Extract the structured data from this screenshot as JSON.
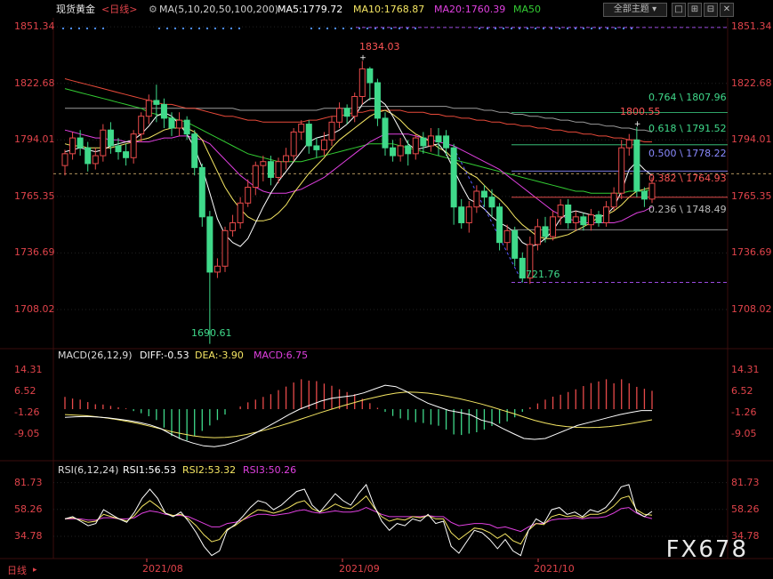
{
  "header": {
    "symbol": "现货黄金",
    "period": "<日线>",
    "ma_spec": "MA(5,10,20,50,100,200)",
    "ma5": "MA5:1779.72",
    "ma10": "MA10:1768.87",
    "ma20": "MA20:1760.39",
    "ma50": "MA50",
    "dropdown": "全部主题",
    "colors": {
      "ma5": "#ffffff",
      "ma10": "#f5e663",
      "ma20": "#e040e0",
      "ma50": "#33cc33",
      "ma100": "#e84a3a",
      "ma200": "#9a9a9a",
      "up": "#e84a4a",
      "down": "#3fd98a"
    }
  },
  "price_axis": {
    "ticks": [
      "1851.34",
      "1822.68",
      "1794.01",
      "1765.35",
      "1736.69",
      "1708.02"
    ]
  },
  "annotations": {
    "high1": "1834.03",
    "low1": "1690.61",
    "high2": "1800.55",
    "low2": "1721.76"
  },
  "fib": {
    "l764": "0.764 \\ 1807.96",
    "l618": "0.618 \\ 1791.52",
    "l500": "0.500 \\ 1778.22",
    "l382": "0.382 \\ 1764.93",
    "l236": "0.236 \\ 1748.49"
  },
  "macd": {
    "title": "MACD(26,12,9)",
    "diff": "DIFF:-0.53",
    "dea": "DEA:-3.90",
    "macd": "MACD:6.75",
    "ticks": [
      "14.31",
      "6.52",
      "-1.26",
      "-9.05"
    ]
  },
  "rsi": {
    "title": "RSI(6,12,24)",
    "rsi1": "RSI1:56.53",
    "rsi2": "RSI2:53.32",
    "rsi3": "RSI3:50.26",
    "ticks": [
      "81.73",
      "58.26",
      "34.78"
    ]
  },
  "time_axis": {
    "period": "日线",
    "labels": [
      "2021/08",
      "2021/09",
      "2021/10"
    ]
  },
  "watermark": "FX678",
  "chart_data": {
    "type": "candlestick",
    "candles": [
      [
        1781,
        1787,
        1776,
        1789
      ],
      [
        1787,
        1795,
        1784,
        1798
      ],
      [
        1795,
        1790,
        1786,
        1799
      ],
      [
        1790,
        1782,
        1778,
        1793
      ],
      [
        1782,
        1786,
        1779,
        1790
      ],
      [
        1786,
        1799,
        1783,
        1802
      ],
      [
        1799,
        1791,
        1787,
        1803
      ],
      [
        1791,
        1788,
        1784,
        1795
      ],
      [
        1788,
        1785,
        1781,
        1792
      ],
      [
        1785,
        1797,
        1782,
        1799
      ],
      [
        1797,
        1806,
        1793,
        1808
      ],
      [
        1806,
        1814,
        1802,
        1817
      ],
      [
        1814,
        1812,
        1803,
        1822
      ],
      [
        1812,
        1805,
        1800,
        1815
      ],
      [
        1805,
        1800,
        1796,
        1808
      ],
      [
        1800,
        1804,
        1796,
        1808
      ],
      [
        1804,
        1797,
        1794,
        1806
      ],
      [
        1797,
        1780,
        1776,
        1799
      ],
      [
        1780,
        1755,
        1750,
        1782
      ],
      [
        1755,
        1727,
        1690.61,
        1758
      ],
      [
        1727,
        1730,
        1724,
        1734
      ],
      [
        1730,
        1748,
        1727,
        1750
      ],
      [
        1748,
        1752,
        1745,
        1756
      ],
      [
        1752,
        1762,
        1749,
        1765
      ],
      [
        1762,
        1770,
        1760,
        1774
      ],
      [
        1770,
        1781,
        1766,
        1783
      ],
      [
        1781,
        1783,
        1773,
        1786
      ],
      [
        1783,
        1775,
        1771,
        1786
      ],
      [
        1775,
        1783,
        1772,
        1785
      ],
      [
        1783,
        1786,
        1779,
        1790
      ],
      [
        1786,
        1798,
        1783,
        1800
      ],
      [
        1798,
        1802,
        1794,
        1804
      ],
      [
        1802,
        1791,
        1787,
        1804
      ],
      [
        1791,
        1789,
        1785,
        1795
      ],
      [
        1789,
        1794,
        1786,
        1798
      ],
      [
        1794,
        1803,
        1791,
        1806
      ],
      [
        1803,
        1810,
        1800,
        1813
      ],
      [
        1810,
        1806,
        1802,
        1812
      ],
      [
        1806,
        1816,
        1803,
        1818
      ],
      [
        1816,
        1830,
        1812,
        1834.03
      ],
      [
        1830,
        1823,
        1814,
        1831
      ],
      [
        1823,
        1805,
        1801,
        1825
      ],
      [
        1805,
        1790,
        1786,
        1808
      ],
      [
        1790,
        1786,
        1783,
        1794
      ],
      [
        1786,
        1791,
        1783,
        1795
      ],
      [
        1791,
        1787,
        1781,
        1794
      ],
      [
        1787,
        1795,
        1784,
        1797
      ],
      [
        1795,
        1791,
        1787,
        1798
      ],
      [
        1791,
        1796,
        1788,
        1800
      ],
      [
        1796,
        1793,
        1786,
        1800
      ],
      [
        1796,
        1790,
        1786,
        1799
      ],
      [
        1790,
        1760,
        1751,
        1792
      ],
      [
        1760,
        1752,
        1749,
        1764
      ],
      [
        1752,
        1760,
        1747,
        1763
      ],
      [
        1760,
        1768,
        1757,
        1771
      ],
      [
        1768,
        1765,
        1760,
        1771
      ],
      [
        1765,
        1760,
        1755,
        1769
      ],
      [
        1760,
        1742,
        1738,
        1762
      ],
      [
        1742,
        1748,
        1738,
        1751
      ],
      [
        1748,
        1734,
        1730,
        1750
      ],
      [
        1734,
        1724,
        1721.76,
        1737
      ],
      [
        1724,
        1741,
        1721,
        1745
      ],
      [
        1741,
        1750,
        1738,
        1754
      ],
      [
        1750,
        1745,
        1742,
        1755
      ],
      [
        1745,
        1755,
        1743,
        1758
      ],
      [
        1755,
        1761,
        1751,
        1764
      ],
      [
        1761,
        1752,
        1749,
        1764
      ],
      [
        1752,
        1755,
        1748,
        1758
      ],
      [
        1755,
        1751,
        1748,
        1757
      ],
      [
        1751,
        1756,
        1748,
        1759
      ],
      [
        1756,
        1752,
        1750,
        1758
      ],
      [
        1752,
        1760,
        1750,
        1763
      ],
      [
        1760,
        1767,
        1758,
        1770
      ],
      [
        1767,
        1790,
        1764,
        1794
      ],
      [
        1790,
        1794,
        1786,
        1797
      ],
      [
        1794,
        1768,
        1765,
        1800.55
      ],
      [
        1768,
        1764,
        1760,
        1770
      ],
      [
        1764,
        1772,
        1762,
        1775
      ]
    ],
    "ma": {
      "ma5": [
        1788,
        1789,
        1790,
        1789,
        1788,
        1789,
        1791,
        1792,
        1793,
        1794,
        1797,
        1801,
        1806,
        1808,
        1806,
        1802,
        1797,
        1790,
        1780,
        1767,
        1754,
        1746,
        1742,
        1740,
        1744,
        1752,
        1760,
        1767,
        1773,
        1778,
        1783,
        1788,
        1793,
        1795,
        1796,
        1797,
        1799,
        1802,
        1806,
        1812,
        1815,
        1815,
        1812,
        1806,
        1799,
        1792,
        1789,
        1790,
        1791,
        1792,
        1787,
        1779,
        1771,
        1764,
        1762,
        1759,
        1755,
        1752,
        1750,
        1747,
        1742,
        1740,
        1741,
        1744,
        1748,
        1754,
        1757,
        1758,
        1757,
        1756,
        1755,
        1756,
        1760,
        1768,
        1779,
        1783,
        1779,
        1776
      ],
      "ma10": [
        1792,
        1791,
        1791,
        1790,
        1790,
        1790,
        1790,
        1791,
        1792,
        1793,
        1794,
        1795,
        1797,
        1799,
        1800,
        1800,
        1800,
        1798,
        1794,
        1786,
        1778,
        1770,
        1764,
        1759,
        1755,
        1753,
        1753,
        1754,
        1757,
        1761,
        1767,
        1772,
        1777,
        1781,
        1785,
        1790,
        1794,
        1797,
        1800,
        1803,
        1806,
        1808,
        1809,
        1807,
        1804,
        1800,
        1797,
        1795,
        1793,
        1790,
        1788,
        1784,
        1780,
        1777,
        1775,
        1771,
        1767,
        1764,
        1760,
        1755,
        1751,
        1748,
        1745,
        1744,
        1744,
        1745,
        1746,
        1748,
        1750,
        1752,
        1755,
        1756,
        1758,
        1761,
        1765,
        1768,
        1769,
        1770
      ],
      "ma20": [
        1799,
        1798,
        1797,
        1796,
        1795,
        1795,
        1794,
        1794,
        1793,
        1793,
        1793,
        1793,
        1794,
        1795,
        1795,
        1796,
        1796,
        1795,
        1794,
        1792,
        1788,
        1784,
        1780,
        1776,
        1773,
        1770,
        1768,
        1767,
        1767,
        1767,
        1768,
        1769,
        1771,
        1773,
        1775,
        1778,
        1781,
        1784,
        1787,
        1790,
        1793,
        1795,
        1797,
        1797,
        1797,
        1797,
        1796,
        1795,
        1794,
        1793,
        1792,
        1791,
        1789,
        1787,
        1785,
        1783,
        1781,
        1779,
        1776,
        1773,
        1770,
        1767,
        1764,
        1761,
        1758,
        1756,
        1754,
        1753,
        1752,
        1752,
        1752,
        1752,
        1752,
        1753,
        1755,
        1757,
        1758,
        1760
      ],
      "ma50": [
        1820,
        1819,
        1818,
        1817,
        1816,
        1815,
        1814,
        1813,
        1812,
        1811,
        1810,
        1808,
        1807,
        1806,
        1805,
        1804,
        1803,
        1801,
        1799,
        1797,
        1795,
        1793,
        1791,
        1789,
        1787,
        1786,
        1785,
        1784,
        1783,
        1783,
        1783,
        1783,
        1784,
        1785,
        1786,
        1787,
        1788,
        1789,
        1790,
        1791,
        1792,
        1792,
        1792,
        1792,
        1791,
        1790,
        1789,
        1788,
        1787,
        1786,
        1785,
        1784,
        1783,
        1782,
        1781,
        1780,
        1779,
        1778,
        1777,
        1776,
        1775,
        1774,
        1773,
        1772,
        1771,
        1770,
        1769,
        1768,
        1768,
        1767,
        1767,
        1767,
        1767,
        1767,
        1768,
        1768,
        1768,
        1769
      ],
      "ma100": [
        1825,
        1824,
        1823,
        1822,
        1821,
        1820,
        1819,
        1818,
        1817,
        1816,
        1815,
        1814,
        1813,
        1812,
        1812,
        1811,
        1810,
        1810,
        1809,
        1808,
        1807,
        1806,
        1806,
        1805,
        1804,
        1804,
        1803,
        1803,
        1803,
        1803,
        1803,
        1803,
        1804,
        1804,
        1805,
        1806,
        1806,
        1807,
        1808,
        1808,
        1809,
        1809,
        1809,
        1809,
        1809,
        1808,
        1808,
        1808,
        1807,
        1807,
        1806,
        1806,
        1805,
        1805,
        1804,
        1804,
        1803,
        1803,
        1802,
        1802,
        1801,
        1801,
        1800,
        1800,
        1799,
        1799,
        1798,
        1798,
        1797,
        1797,
        1796,
        1796,
        1795,
        1795,
        1794,
        1794,
        1793,
        1793
      ],
      "ma200": [
        1810,
        1810,
        1810,
        1810,
        1810,
        1810,
        1810,
        1810,
        1810,
        1810,
        1810,
        1810,
        1810,
        1810,
        1810,
        1810,
        1810,
        1810,
        1810,
        1810,
        1810,
        1810,
        1810,
        1809,
        1809,
        1809,
        1809,
        1809,
        1809,
        1809,
        1809,
        1809,
        1809,
        1809,
        1810,
        1810,
        1810,
        1810,
        1810,
        1811,
        1811,
        1811,
        1811,
        1811,
        1811,
        1811,
        1811,
        1811,
        1811,
        1811,
        1811,
        1810,
        1810,
        1810,
        1810,
        1809,
        1809,
        1808,
        1808,
        1807,
        1807,
        1806,
        1806,
        1805,
        1805,
        1804,
        1804,
        1803,
        1803,
        1802,
        1802,
        1801,
        1801,
        1800,
        1800,
        1799,
        1799,
        1798
      ]
    },
    "fib_levels": [
      1807.96,
      1791.52,
      1778.22,
      1764.93,
      1748.49
    ],
    "price_ylim": [
      1690,
      1855
    ],
    "macd_hist": [
      4.5,
      3.9,
      3.5,
      2.6,
      1.8,
      1.7,
      1.2,
      0.7,
      0.3,
      -0.7,
      -1.5,
      -2.6,
      -4,
      -6.8,
      -9.9,
      -11,
      -11.5,
      -10,
      -8,
      -6,
      -4,
      -2,
      0,
      1,
      2.5,
      3.5,
      4.5,
      5.5,
      7,
      8.3,
      9.8,
      11,
      10.5,
      10.3,
      9.4,
      8.6,
      7.3,
      6.3,
      5.5,
      3.8,
      2.2,
      0.5,
      -1,
      -2.5,
      -3.4,
      -4,
      -4.8,
      -5.1,
      -5.7,
      -6.1,
      -7.5,
      -9.3,
      -9.5,
      -9,
      -8.5,
      -7.5,
      -6.2,
      -5.3,
      -4.5,
      -3,
      -1,
      0.7,
      2.1,
      3.5,
      4.6,
      5.3,
      6.3,
      7.3,
      8.5,
      9.6,
      10.2,
      11,
      9.5,
      11,
      9.5,
      8.2,
      7.5,
      6.75
    ],
    "macd_diff": [
      -3,
      -2.8,
      -2.7,
      -2.9,
      -3.2,
      -3.7,
      -4.2,
      -4.9,
      -5.8,
      -7.2,
      -9.3,
      -11.2,
      -12.5,
      -13.5,
      -13.8,
      -13.2,
      -12,
      -10.5,
      -8.5,
      -6.4,
      -4.2,
      -2,
      0,
      1.5,
      3,
      4,
      4.5,
      5,
      6,
      7.4,
      8.8,
      8.3,
      6.5,
      4.2,
      2.2,
      0.8,
      -0.5,
      -1.2,
      -2.1,
      -4,
      -5,
      -7.1,
      -9,
      -10.8,
      -11.1,
      -10.8,
      -9.2,
      -7.6,
      -6,
      -5,
      -4,
      -3,
      -2,
      -1.2,
      -0.5,
      -0.53
    ],
    "macd_dea": [
      -2,
      -2.2,
      -2.4,
      -2.8,
      -3.3,
      -3.9,
      -4.6,
      -5.4,
      -6.3,
      -7.3,
      -8.3,
      -9.1,
      -9.8,
      -10.3,
      -10.5,
      -10.4,
      -10,
      -9.3,
      -8.4,
      -7.4,
      -6.3,
      -5.1,
      -3.8,
      -2.5,
      -1.2,
      0,
      1.2,
      2.3,
      3.4,
      4.3,
      5.2,
      5.9,
      6.3,
      6.2,
      5.9,
      5.3,
      4.6,
      3.8,
      2.9,
      1.9,
      0.8,
      -0.4,
      -1.6,
      -2.9,
      -4.1,
      -5.1,
      -5.9,
      -6.4,
      -6.7,
      -6.8,
      -6.7,
      -6.4,
      -5.9,
      -5.3,
      -4.6,
      -3.9
    ],
    "macd_ylim": [
      -17,
      18
    ],
    "rsi1": [
      50,
      52,
      48,
      44,
      46,
      58,
      54,
      50,
      47,
      56,
      68,
      76,
      68,
      55,
      52,
      56,
      48,
      38,
      26,
      18,
      22,
      40,
      45,
      52,
      60,
      66,
      64,
      58,
      62,
      68,
      74,
      76,
      62,
      56,
      64,
      72,
      66,
      62,
      72,
      80,
      62,
      48,
      40,
      46,
      44,
      50,
      48,
      54,
      46,
      48,
      26,
      20,
      30,
      40,
      38,
      32,
      24,
      32,
      22,
      18,
      40,
      50,
      46,
      58,
      60,
      54,
      56,
      52,
      58,
      56,
      60,
      68,
      78,
      80,
      56,
      52,
      56.53
    ],
    "rsi2": [
      50,
      51,
      49,
      47,
      48,
      54,
      52,
      50,
      48,
      53,
      61,
      66,
      61,
      55,
      53,
      54,
      50,
      44,
      36,
      30,
      32,
      41,
      44,
      49,
      54,
      58,
      57,
      55,
      57,
      60,
      64,
      66,
      59,
      56,
      59,
      63,
      60,
      59,
      64,
      70,
      60,
      52,
      48,
      50,
      49,
      52,
      51,
      53,
      50,
      50,
      38,
      32,
      37,
      42,
      41,
      38,
      33,
      37,
      31,
      28,
      40,
      46,
      45,
      52,
      54,
      52,
      53,
      51,
      54,
      54,
      56,
      61,
      68,
      70,
      58,
      54,
      53.32
    ],
    "rsi3": [
      50,
      50,
      50,
      49,
      49,
      51,
      51,
      50,
      50,
      51,
      55,
      57,
      56,
      54,
      53,
      53,
      52,
      49,
      46,
      43,
      43,
      46,
      47,
      49,
      52,
      54,
      54,
      53,
      54,
      55,
      57,
      58,
      56,
      55,
      56,
      57,
      56,
      56,
      57,
      60,
      57,
      54,
      52,
      52,
      52,
      52,
      52,
      53,
      52,
      52,
      47,
      44,
      45,
      46,
      46,
      45,
      42,
      43,
      41,
      39,
      43,
      46,
      46,
      49,
      50,
      50,
      51,
      50,
      51,
      51,
      52,
      55,
      59,
      60,
      55,
      52,
      50.26
    ]
  }
}
